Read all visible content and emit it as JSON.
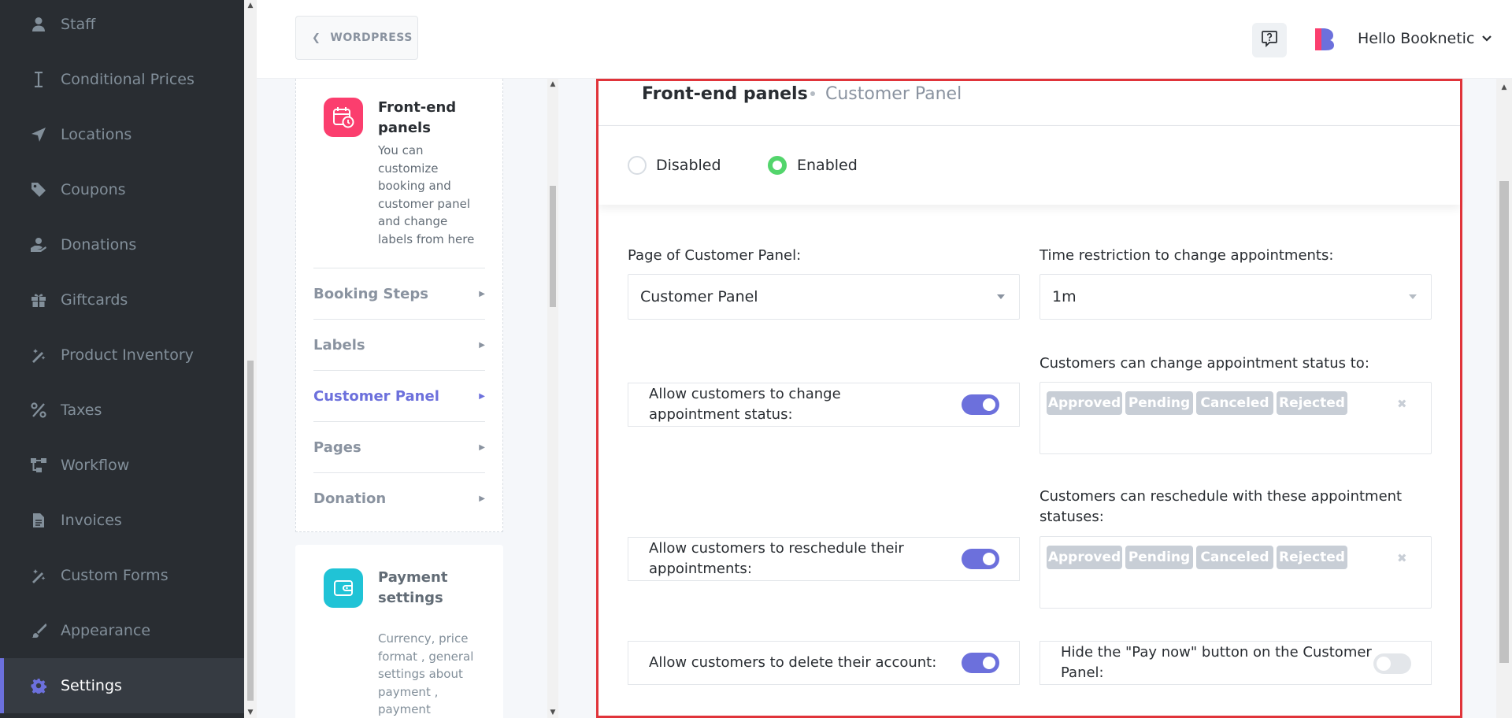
{
  "sidebar": {
    "items": [
      {
        "label": "Staff",
        "icon": "user-icon",
        "active": false
      },
      {
        "label": "Conditional Prices",
        "icon": "cursor-text-icon",
        "active": false
      },
      {
        "label": "Locations",
        "icon": "location-arrow-icon",
        "active": false
      },
      {
        "label": "Coupons",
        "icon": "tag-icon",
        "active": false
      },
      {
        "label": "Donations",
        "icon": "donate-hand-icon",
        "active": false
      },
      {
        "label": "Giftcards",
        "icon": "gift-icon",
        "active": false
      },
      {
        "label": "Product Inventory",
        "icon": "magic-wand-icon",
        "active": false
      },
      {
        "label": "Taxes",
        "icon": "percent-icon",
        "active": false
      },
      {
        "label": "Workflow",
        "icon": "workflow-icon",
        "active": false
      },
      {
        "label": "Invoices",
        "icon": "document-icon",
        "active": false
      },
      {
        "label": "Custom Forms",
        "icon": "magic-wand-icon",
        "active": false
      },
      {
        "label": "Appearance",
        "icon": "brush-icon",
        "active": false
      },
      {
        "label": "Settings",
        "icon": "gear-icon",
        "active": true
      }
    ]
  },
  "topbar": {
    "back_label": "WORDPRESS",
    "user_greeting": "Hello Booknetic"
  },
  "settings_nav": {
    "frontend": {
      "title": "Front-end panels",
      "description": "You can customize booking and customer panel and change labels from here"
    },
    "sub_items": [
      {
        "label": "Booking Steps",
        "active": false
      },
      {
        "label": "Labels",
        "active": false
      },
      {
        "label": "Customer Panel",
        "active": true
      },
      {
        "label": "Pages",
        "active": false
      },
      {
        "label": "Donation",
        "active": false
      }
    ],
    "payment": {
      "title": "Payment settings",
      "description": "Currency, price format , general settings about payment , payment methods and so"
    }
  },
  "main": {
    "breadcrumb": {
      "section": "Front-end panels",
      "page": "Customer Panel"
    },
    "status": {
      "disabled_label": "Disabled",
      "enabled_label": "Enabled",
      "selected": "Enabled"
    },
    "page_field": {
      "label": "Page of Customer Panel:",
      "value": "Customer Panel"
    },
    "time_field": {
      "label": "Time restriction to change appointments:",
      "value": "1m"
    },
    "change_status": {
      "toggle_label": "Allow customers to change appointment status:",
      "enabled": true
    },
    "change_status_to": {
      "label": "Customers can change appointment status to:",
      "tags": [
        "Approved",
        "Pending",
        "Canceled",
        "Rejected"
      ],
      "clear_symbol": "✖"
    },
    "reschedule": {
      "toggle_label": "Allow customers to reschedule their appointments:",
      "enabled": true
    },
    "reschedule_statuses": {
      "label": "Customers can reschedule with these appointment statuses:",
      "tags": [
        "Approved",
        "Pending",
        "Canceled",
        "Rejected"
      ],
      "clear_symbol": "✖"
    },
    "delete_account": {
      "toggle_label": "Allow customers to delete their account:",
      "enabled": true
    },
    "hide_pay_now": {
      "toggle_label": "Hide the \"Pay now\" button on the Customer Panel:",
      "enabled": false
    }
  },
  "colors": {
    "accent": "#6c70dc",
    "sidebar_bg": "#292d32",
    "enabled_green": "#53d56c",
    "frontend_icon": "#fb3e6e",
    "payment_icon": "#20c3d6",
    "highlight_border": "#e0343a"
  }
}
